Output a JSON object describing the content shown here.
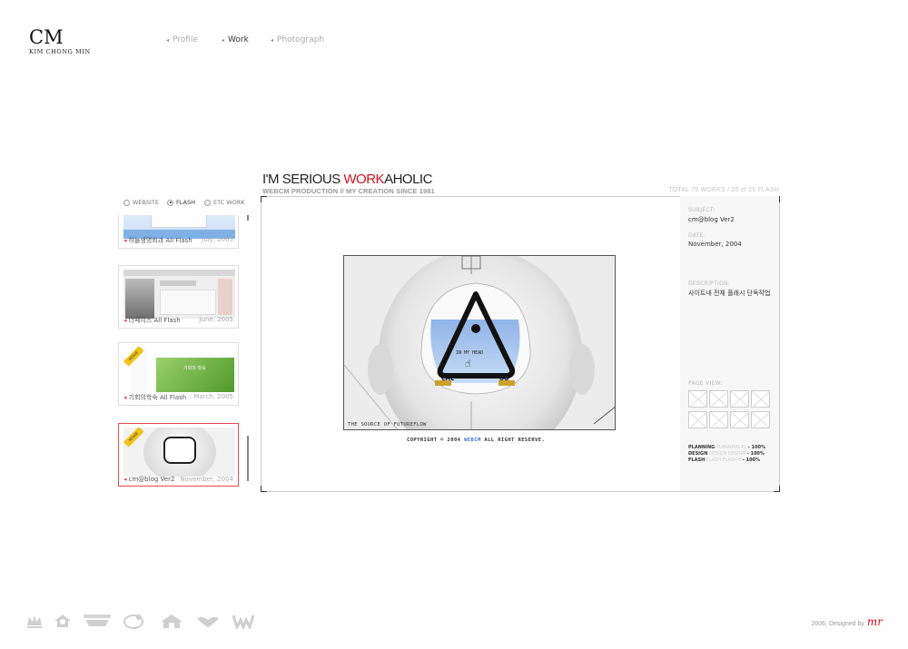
{
  "logo": {
    "mark": "CM",
    "name": "KIM CHONG MIN"
  },
  "nav": {
    "items": [
      {
        "label": "Profile",
        "active": false
      },
      {
        "label": "Work",
        "active": true
      },
      {
        "label": "Photograph",
        "active": false
      }
    ]
  },
  "heading": {
    "main_a": "I'M SERIOUS ",
    "main_b": "WORK",
    "main_c": "AHOLIC",
    "sub": "WEBCM PRODUCTION // MY CREATION SINCE 1981",
    "total": "TOTAL 75 WORKS / 25 of 25 FLASH"
  },
  "filters": [
    {
      "label": "WEBSITE",
      "selected": false
    },
    {
      "label": "FLASH",
      "selected": true
    },
    {
      "label": "ETC WORK",
      "selected": false
    }
  ],
  "works": [
    {
      "title": "하늘생명화과 All Flash",
      "date": "July, 2005"
    },
    {
      "title": "더페이스 All Flash",
      "date": "June, 2005"
    },
    {
      "title": "기회의학숙 All Flash",
      "date": "March, 2005"
    },
    {
      "title": "cm@blog Ver2",
      "date": "November, 2004"
    }
  ],
  "thumb_texts": {
    "movie": "MOVIE",
    "forest": "기회의 학숙"
  },
  "detail": {
    "subject_label": "SUBJECT:",
    "subject": "cm@blog Ver2",
    "date_label": "DATE:",
    "date": "November, 2004",
    "desc_label": "DESCRIPTION:",
    "desc": "사이트내 전체 플래시 단독작업",
    "pageview_label": "PAGE VIEW:",
    "credits": [
      {
        "role": "PLANNING",
        "faded": "PLANNING PL",
        "pct": "- 100%"
      },
      {
        "role": "DESIGN",
        "faded": "DESIGN DESIGN",
        "pct": "- 100%"
      },
      {
        "role": "FLASH",
        "faded": "FLASH FLASH F",
        "pct": "- 100%"
      }
    ]
  },
  "preview": {
    "caption": "THE SOURCE OF FUTUREFLOW",
    "in_my_head": "IN MY HEAD",
    "cml": "CML",
    "og": "OG",
    "copyright_a": "COPYRIGHT © 2004 ",
    "copyright_b": "WEBCM",
    "copyright_c": " ALL RIGHT RESERVE."
  },
  "footer": {
    "designed": "2006, Designed by",
    "signature": "mr"
  },
  "colors": {
    "accent": "#d4121f",
    "selected_border": "#e8474c",
    "link_blue": "#3a6fd6"
  }
}
